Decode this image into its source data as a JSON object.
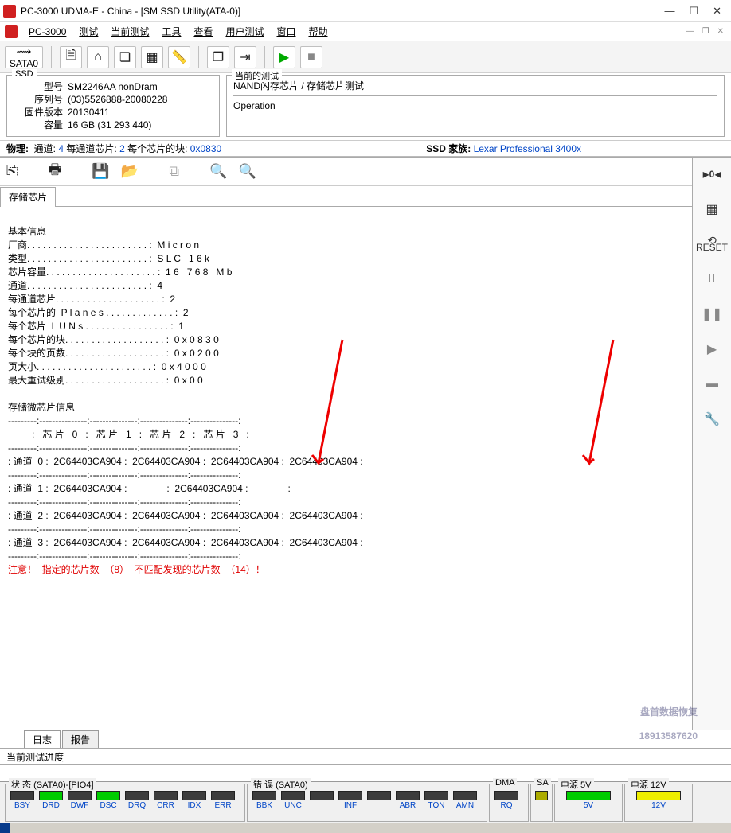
{
  "window": {
    "title": "PC-3000 UDMA-E - China - [SM SSD Utility(ATA-0)]",
    "min": "—",
    "max": "☐",
    "close": "✕"
  },
  "menu": {
    "app": "PC-3000",
    "items": [
      "测试",
      "当前测试",
      "工具",
      "查看",
      "用户测试",
      "窗口",
      "帮助"
    ]
  },
  "toolbar": {
    "sata_label": "SATA0"
  },
  "ssd": {
    "legend": "SSD",
    "model_lbl": "型号",
    "model": "SM2246AA nonDram",
    "serial_lbl": "序列号",
    "serial": "(03)5526888-20080228",
    "fw_lbl": "固件版本",
    "fw": "20130411",
    "cap_lbl": "容量",
    "cap": "16 GB (31 293 440)"
  },
  "op": {
    "legend": "当前的测试",
    "path": "NAND闪存芯片 / 存储芯片测试",
    "op_lbl": "Operation"
  },
  "phys": {
    "label": "物理:",
    "ch_lbl": "通道:",
    "ch": "4",
    "pcc_lbl": "每通道芯片:",
    "pcc": "2",
    "bpc_lbl": "每个芯片的块:",
    "bpc": "0x0830",
    "family_lbl": "SSD 家族:",
    "family": "Lexar Professional 3400x"
  },
  "tab": {
    "storage": "存储芯片"
  },
  "content": {
    "basic_title": "基本信息",
    "vendor_lbl": "厂商. . . . . . . . . . . . . . . . . . . . . . . :",
    "vendor": "  M i c r o n",
    "type_lbl": "类型. . . . . . . . . . . . . . . . . . . . . . . :",
    "type": "  S L C   1 6 k",
    "cap_lbl": "芯片容量. . . . . . . . . . . . . . . . . . . . . :",
    "cap": "  1 6   7 6 8   M b",
    "ch_lbl": "通道. . . . . . . . . . . . . . . . . . . . . . . :",
    "ch": "  4",
    "cpc_lbl": "每通道芯片. . . . . . . . . . . . . . . . . . . . :",
    "cpc": "  2",
    "planes_lbl": "每个芯片的  P l a n e s . . . . . . . . . . . . . :",
    "planes": "  2",
    "luns_lbl": "每个芯片  L U N s . . . . . . . . . . . . . . . . :",
    "luns": "  1",
    "blocks_lbl": "每个芯片的块. . . . . . . . . . . . . . . . . . . :",
    "blocks": "  0 x 0 8 3 0",
    "ppb_lbl": "每个块的页数. . . . . . . . . . . . . . . . . . . :",
    "ppb": "  0 x 0 2 0 0",
    "pgsize_lbl": "页大小. . . . . . . . . . . . . . . . . . . . . . :",
    "pgsize": "  0 x 4 0 0 0",
    "retry_lbl": "最大重试级别. . . . . . . . . . . . . . . . . . . :",
    "retry": "  0 x 0 0",
    "chip_info": "存储微芯片信息",
    "hr": "---------:---------------:---------------:---------------:---------------:",
    "hdr": "         :   芯 片   0   :   芯 片   1   :   芯 片   2   :   芯 片   3   :",
    "r0": ": 通道  0 :  2C64403CA904 :  2C64403CA904 :  2C64403CA904 :  2C64403CA904 :",
    "r1": ": 通道  1 :  2C64403CA904 :               :  2C64403CA904 :               :",
    "r2": ": 通道  2 :  2C64403CA904 :  2C64403CA904 :  2C64403CA904 :  2C64403CA904 :",
    "r3": ": 通道  3 :  2C64403CA904 :  2C64403CA904 :  2C64403CA904 :  2C64403CA904 :",
    "warn": "注意！  指定的芯片数  （8）  不匹配发现的芯片数  （14）！"
  },
  "bottom_tabs": {
    "log": "日志",
    "report": "报告"
  },
  "progress": {
    "label": "当前测试进度"
  },
  "status": {
    "state_legend": "状 态 (SATA0)-[PIO4]",
    "err_legend": "错 误 (SATA0)",
    "dma_legend": "DMA",
    "sa_legend": "SA",
    "pwr5_legend": "电源 5V",
    "pwr12_legend": "电源 12V",
    "state_labels": [
      "BSY",
      "DRD",
      "DWF",
      "DSC",
      "DRQ",
      "CRR",
      "IDX",
      "ERR"
    ],
    "err_labels": [
      "BBK",
      "UNC",
      "",
      "INF",
      "",
      "ABR",
      "TON",
      "AMN"
    ],
    "dma_label": "RQ",
    "pwr5_label": "5V",
    "pwr12_label": "12V"
  },
  "right_tools": {
    "reset": "RESET"
  },
  "watermark": {
    "l1": "盘首数据恢复",
    "l2": "18913587620"
  }
}
